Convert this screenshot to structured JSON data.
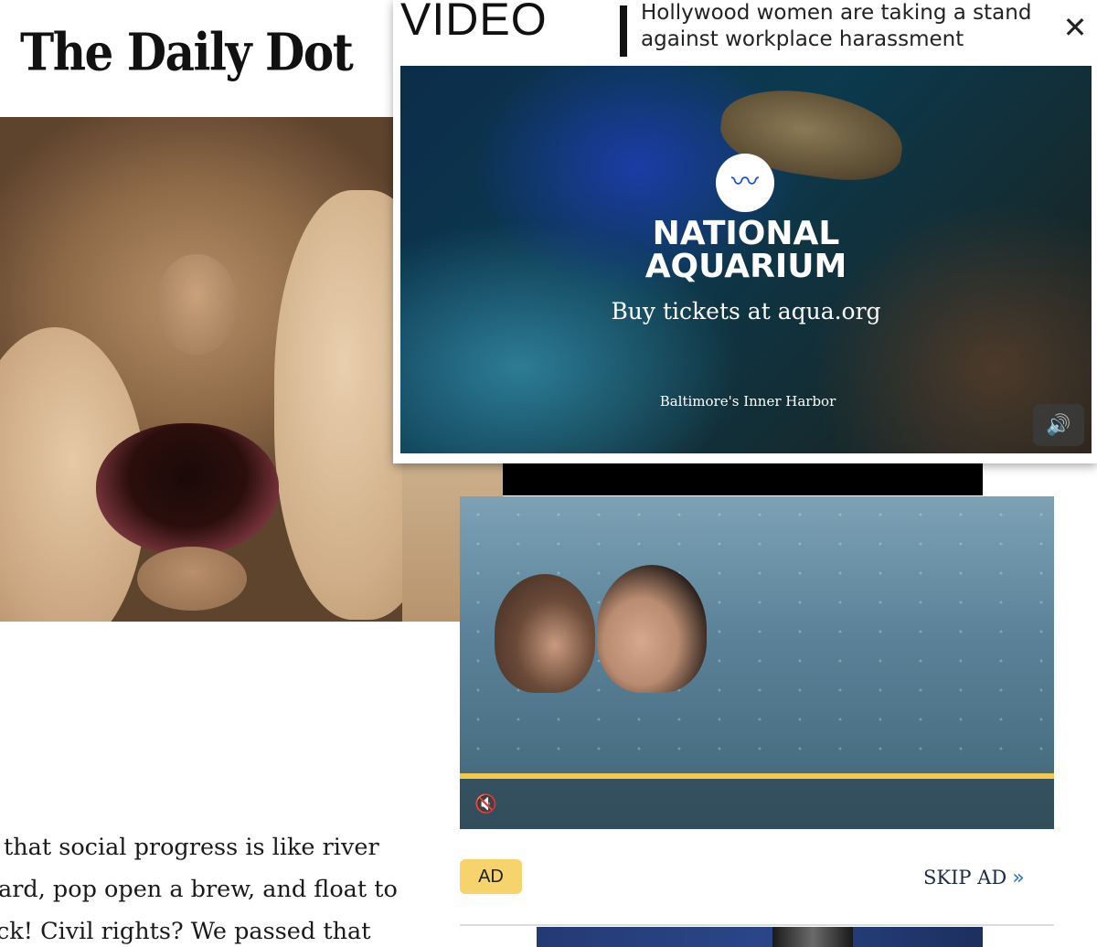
{
  "site": {
    "logo_text": "The Daily Dot"
  },
  "article": {
    "line1": "that social progress is like river",
    "line2": "ard, pop open a brew, and float to",
    "line3": "ck! Civil rights? We passed that"
  },
  "video_player": {
    "label": "VIDEO",
    "title": "Hollywood women are taking a stand against workplace harassment",
    "close_glyph": "✕",
    "ad": {
      "brand": "NATIONAL AQUARIUM",
      "cta": "Buy tickets at aqua.org",
      "location": "Baltimore's Inner Harbor"
    },
    "volume_glyph": "🔊"
  },
  "ad_player": {
    "progress_fraction": 1.0,
    "mute_glyph": "🔇",
    "badge": "AD",
    "skip_label": "SKIP AD",
    "skip_glyph": "»"
  },
  "colors": {
    "ad_badge": "#f6d36b",
    "progress_bar": "#f2c94c",
    "skip_chevron": "#2b6fd6"
  },
  "icons": {
    "close": "close-icon",
    "volume": "volume-icon",
    "mute": "mute-icon",
    "skip": "double-chevron-right-icon",
    "aquarium_logo": "fish-emblem-icon"
  }
}
